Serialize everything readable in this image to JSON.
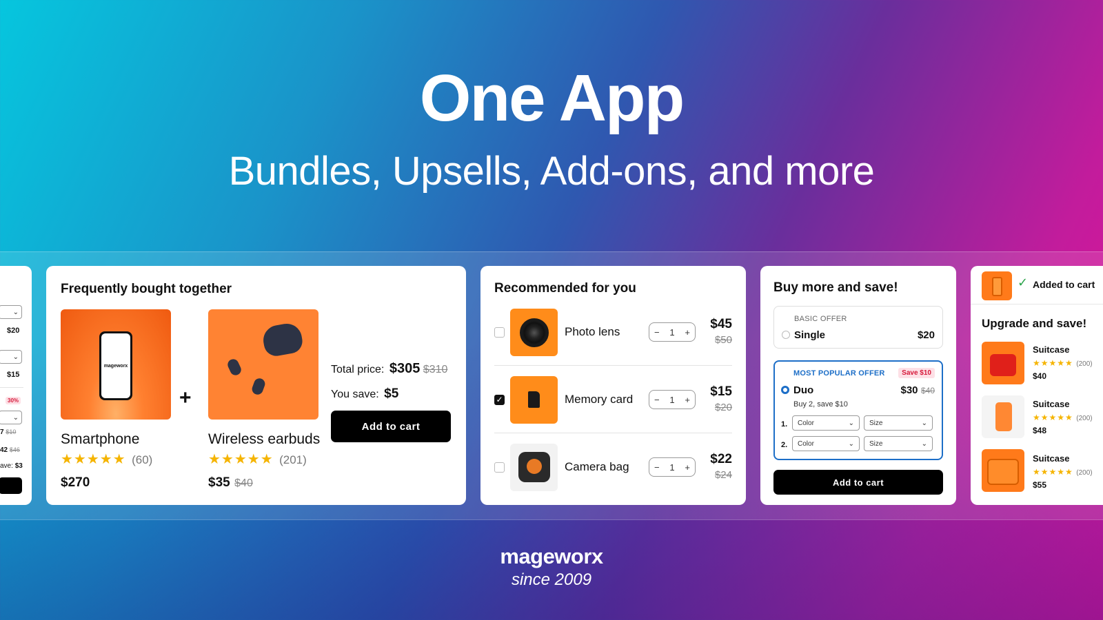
{
  "hero": {
    "title": "One App",
    "subtitle": "Bundles, Upsells, Add-ons, and more"
  },
  "footer": {
    "brand": "mageworx",
    "since": "since 2009"
  },
  "left_partial": {
    "prices": [
      "$20",
      "$15"
    ],
    "badge": "30%",
    "p1": "7",
    "p1_old": "$10",
    "p2": "42",
    "p2_old": "$46",
    "save": "ave:",
    "save_val": "$3"
  },
  "fbt": {
    "title": "Frequently bought together",
    "plus": "+",
    "products": [
      {
        "name": "Smartphone",
        "stars": "★★★★★",
        "reviews": "(60)",
        "price": "$270",
        "old_price": "",
        "screen_label": "mageworx"
      },
      {
        "name": "Wireless earbuds",
        "stars": "★★★★★",
        "reviews": "(201)",
        "price": "$35",
        "old_price": "$40"
      }
    ],
    "total_label": "Total price:",
    "total": "$305",
    "total_old": "$310",
    "save_label": "You save:",
    "save": "$5",
    "add_to_cart": "Add to cart"
  },
  "recommended": {
    "title": "Recommended for you",
    "items": [
      {
        "name": "Photo lens",
        "qty": "1",
        "price": "$45",
        "old_price": "$50",
        "checked": false
      },
      {
        "name": "Memory card",
        "qty": "1",
        "price": "$15",
        "old_price": "$20",
        "checked": true
      },
      {
        "name": "Camera bag",
        "qty": "1",
        "price": "$22",
        "old_price": "$24",
        "checked": false
      }
    ],
    "minus": "−",
    "plus": "+"
  },
  "buymore": {
    "title": "Buy more and save!",
    "basic": {
      "label": "BASIC OFFER",
      "option": "Single",
      "price": "$20"
    },
    "popular": {
      "label": "MOST POPULAR OFFER",
      "badge": "Save $10",
      "option": "Duo",
      "price": "$30",
      "old_price": "$40",
      "note": "Buy 2, save $10",
      "rows": [
        {
          "num": "1.",
          "color": "Color",
          "size": "Size"
        },
        {
          "num": "2.",
          "color": "Color",
          "size": "Size"
        }
      ]
    },
    "add_to_cart": "Add to cart"
  },
  "upgrade": {
    "added": "Added to cart",
    "title": "Upgrade and save!",
    "items": [
      {
        "name": "Suitcase",
        "stars": "★★★★★",
        "reviews": "(200)",
        "price": "$40"
      },
      {
        "name": "Suitcase",
        "stars": "★★★★★",
        "reviews": "(200)",
        "price": "$48"
      },
      {
        "name": "Suitcase",
        "stars": "★★★★★",
        "reviews": "(200)",
        "price": "$55"
      }
    ]
  },
  "colors": {
    "orange": "#ff7a1a",
    "accent_blue": "#1c6ec7",
    "save_badge_bg": "#fde0e6",
    "save_badge_text": "#d6193a",
    "star": "#f5b400"
  }
}
